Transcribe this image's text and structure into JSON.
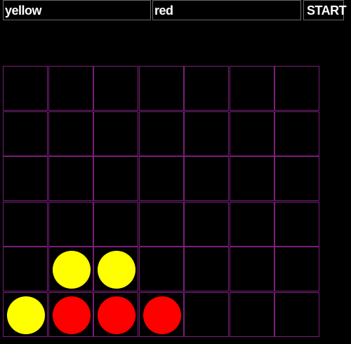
{
  "players": {
    "player1_value": "yellow",
    "player2_value": "red"
  },
  "start_label": "START",
  "board": {
    "columns": 7,
    "rows": 6,
    "cells": [
      [
        "",
        "",
        "",
        "",
        "",
        "",
        ""
      ],
      [
        "",
        "",
        "",
        "",
        "",
        "",
        ""
      ],
      [
        "",
        "",
        "",
        "",
        "",
        "",
        ""
      ],
      [
        "",
        "",
        "",
        "",
        "",
        "",
        ""
      ],
      [
        "",
        "yellow",
        "yellow",
        "",
        "",
        "",
        ""
      ],
      [
        "yellow",
        "red",
        "red",
        "red",
        "",
        "",
        ""
      ]
    ]
  },
  "colors": {
    "background": "#000000",
    "grid_line": "#7a1f7a",
    "yellow": "#ffff00",
    "red": "#ff0000",
    "text": "#ffffff"
  }
}
